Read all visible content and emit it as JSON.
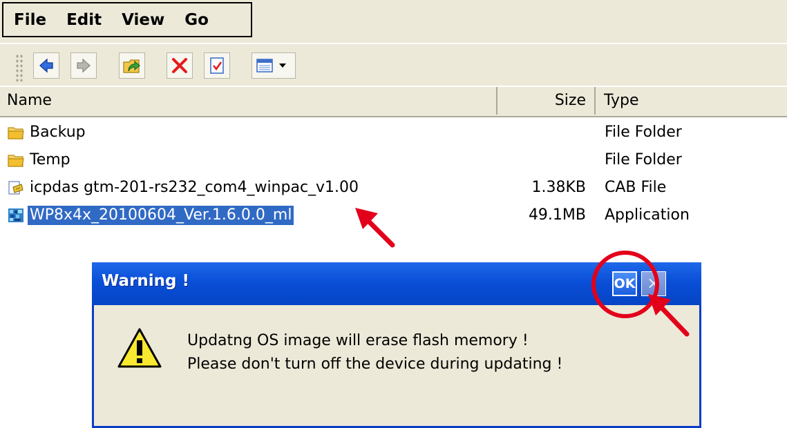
{
  "menu": {
    "items": [
      {
        "label": "File"
      },
      {
        "label": "Edit"
      },
      {
        "label": "View"
      },
      {
        "label": "Go"
      }
    ]
  },
  "toolbar": {
    "buttons": [
      "back-arrow-icon",
      "forward-arrow-icon",
      "up-folder-icon",
      "delete-icon",
      "properties-icon",
      "view-menu-icon"
    ]
  },
  "list": {
    "headers": {
      "name": "Name",
      "size": "Size",
      "type": "Type"
    },
    "rows": [
      {
        "name": "Backup",
        "size": "",
        "type": "File Folder",
        "icon": "folder-icon"
      },
      {
        "name": "Temp",
        "size": "",
        "type": "File Folder",
        "icon": "folder-icon"
      },
      {
        "name": "icpdas gtm-201-rs232_com4_winpac_v1.00",
        "size": "1.38KB",
        "type": "CAB File",
        "icon": "cab-file-icon"
      },
      {
        "name": "WP8x4x_20100604_Ver.1.6.0.0_ml",
        "size": "49.1MB",
        "type": "Application",
        "icon": "application-icon",
        "selected": true
      }
    ]
  },
  "dialog": {
    "title": "Warning !",
    "ok_label": "OK",
    "close_label": "×",
    "message_line1": "Updatng OS image will erase flash memory !",
    "message_line2": "Please don't turn off the device during updating !"
  },
  "colors": {
    "selection": "#316ac5",
    "titlebar": "#0a4fd8",
    "annotation": "#e3001b",
    "chrome": "#ece9d8"
  }
}
